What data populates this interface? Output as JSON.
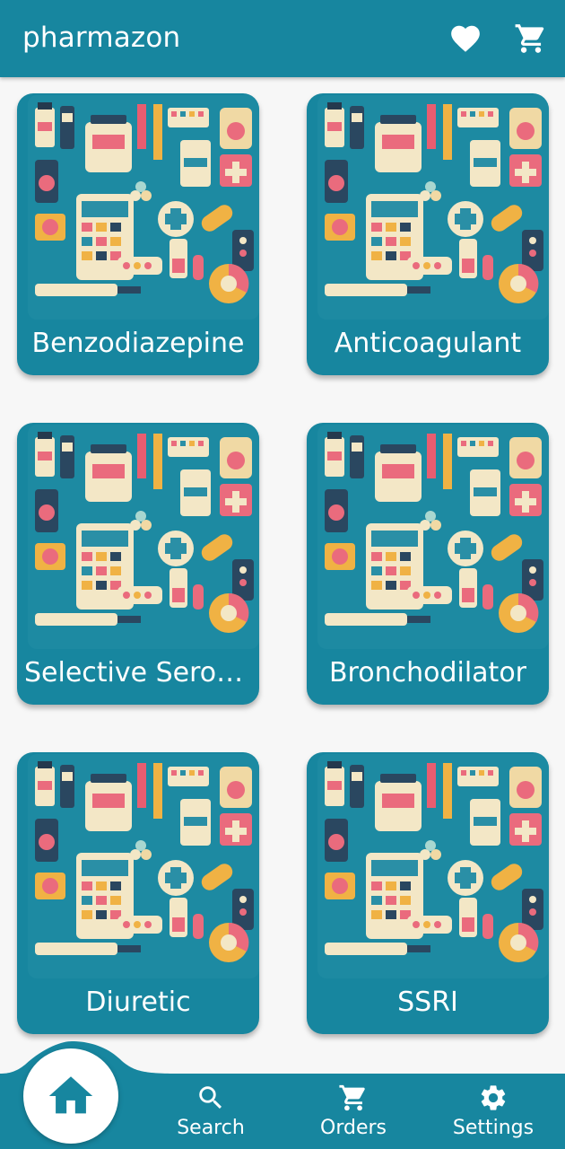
{
  "app": {
    "title": "pharmazon",
    "colors": {
      "primary": "#17869f",
      "background": "#f7f7f7",
      "on_primary": "#ffffff"
    },
    "icons": {
      "favorites": "heart-icon",
      "cart": "cart-icon"
    }
  },
  "categories": [
    {
      "label": "Benzodiazepine"
    },
    {
      "label": "Anticoagulant"
    },
    {
      "label": "Selective Serot…"
    },
    {
      "label": "Bronchodilator"
    },
    {
      "label": "Diuretic"
    },
    {
      "label": "SSRI"
    }
  ],
  "bottom_nav": {
    "items": [
      {
        "label": "",
        "icon": "home-icon",
        "active": true
      },
      {
        "label": "Search",
        "icon": "search-icon",
        "active": false
      },
      {
        "label": "Orders",
        "icon": "cart-icon",
        "active": false
      },
      {
        "label": "Settings",
        "icon": "gear-icon",
        "active": false
      }
    ]
  }
}
